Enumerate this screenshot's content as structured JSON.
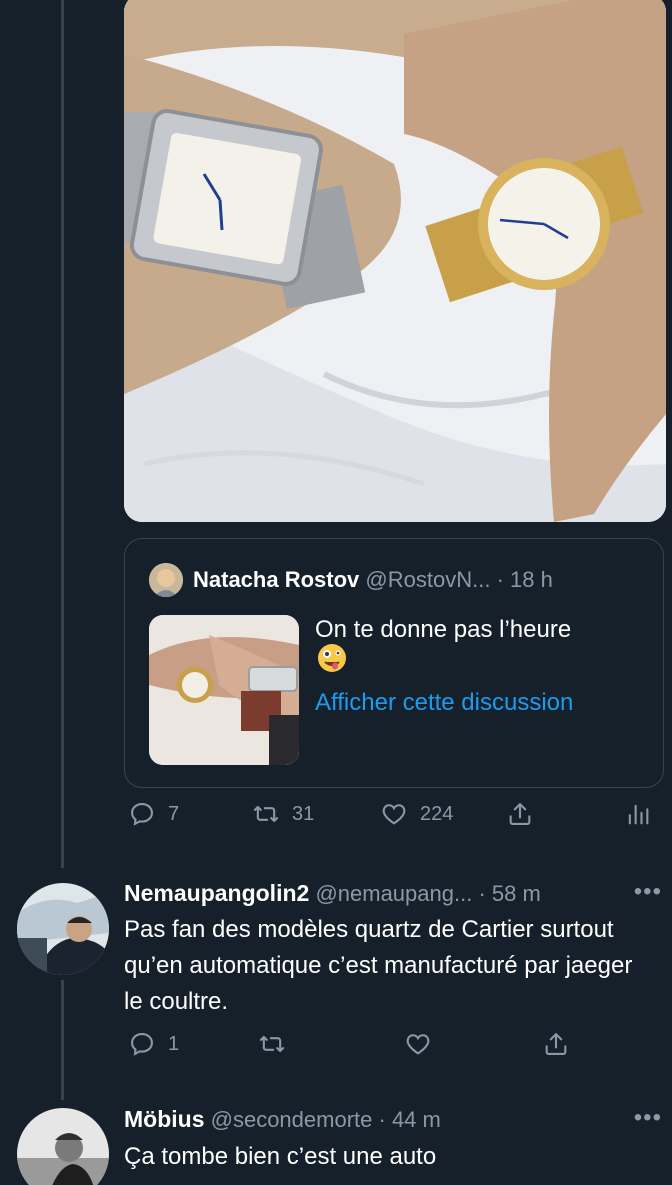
{
  "quoted_tweet": {
    "name": "Natacha Rostov",
    "handle": "@RostovN...",
    "time": "· 18 h",
    "text": "On te donne pas l’heure",
    "link": "Afficher cette discussion"
  },
  "main_actions": {
    "replies": "7",
    "retweets": "31",
    "likes": "224"
  },
  "replies": [
    {
      "name": "Nemaupangolin2",
      "handle": "@nemaupang...",
      "time": "· 58 m",
      "text": "Pas fan des modèles quartz de Cartier surtout qu’en automatique c’est manufacturé par jaeger le coultre.",
      "reply_count": "1",
      "more": "•••"
    },
    {
      "name": "Möbius",
      "handle": "@secondemorte",
      "time": "· 44 m",
      "text": "Ça tombe bien c’est une auto",
      "more": "•••"
    }
  ],
  "colors": {
    "background": "#15202b",
    "border": "#38444d",
    "muted": "#8b98a5",
    "link": "#1d9bf0"
  }
}
